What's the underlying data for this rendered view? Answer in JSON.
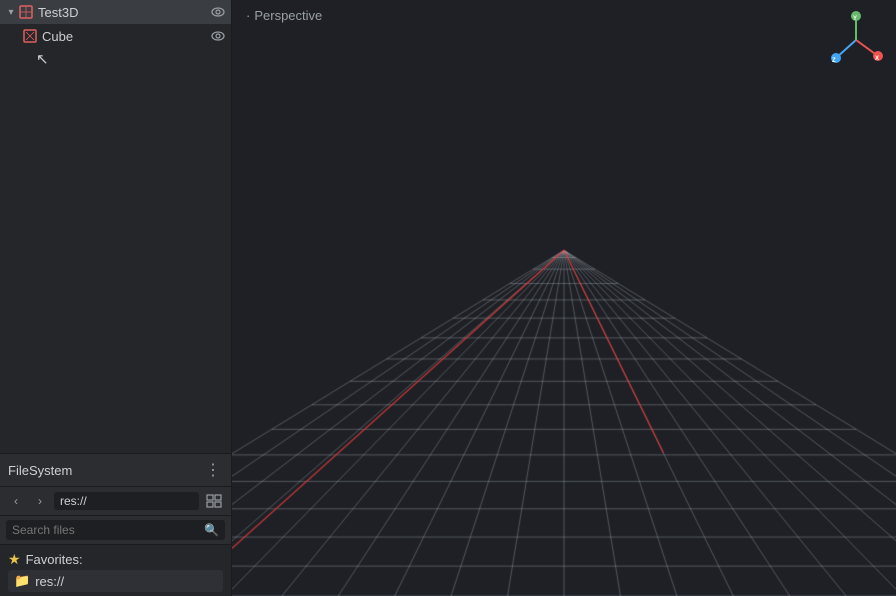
{
  "viewport": {
    "label": "Perspective",
    "label_dot": "·"
  },
  "scene_tree": {
    "items": [
      {
        "id": "test3d",
        "label": "Test3D",
        "type": "3d",
        "expanded": true,
        "selected": true,
        "has_children": true,
        "indent": 0
      },
      {
        "id": "cube",
        "label": "Cube",
        "type": "mesh",
        "expanded": false,
        "selected": false,
        "has_children": false,
        "indent": 1
      }
    ]
  },
  "filesystem": {
    "title": "FileSystem",
    "path": "res://",
    "search_placeholder": "Search files",
    "favorites_label": "Favorites:",
    "favorites_items": [
      {
        "label": "res://"
      }
    ]
  },
  "axis": {
    "y_color": "#66bb6a",
    "x_color": "#ef5350",
    "z_color": "#42a5f5"
  }
}
